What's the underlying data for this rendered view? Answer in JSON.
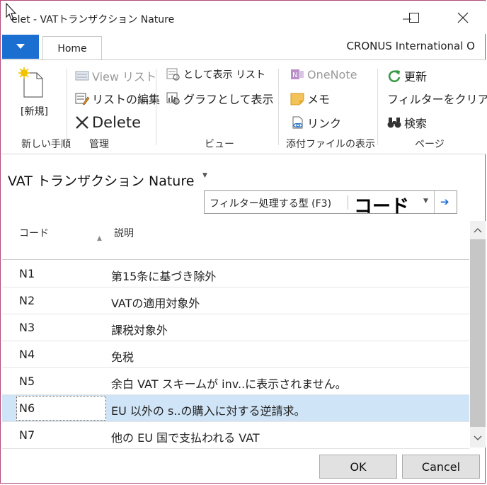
{
  "window": {
    "title": "elet - VATトランザクション  Nature",
    "company": "CRONUS International O"
  },
  "ribbon": {
    "tab_home": "Home",
    "new": {
      "label": "[新規]",
      "group": "新しい手順"
    },
    "manage": {
      "view_list": "View リスト",
      "edit_list": "リストの編集",
      "delete": "Delete",
      "group": "管理"
    },
    "view": {
      "show_as_list": "として表示 リスト",
      "show_as_chart": "グラフとして表示",
      "group": "ビュー"
    },
    "attachments": {
      "onenote": "OneNote",
      "notes": "メモ",
      "links": "リンク",
      "group": "添付ファイルの表示"
    },
    "page": {
      "refresh": "更新",
      "clear_filter": "フィルターをクリア",
      "find": "検索",
      "group": "ページ"
    }
  },
  "page": {
    "title": "VAT トランザクション  Nature"
  },
  "filter": {
    "label": "フィルター処理する型 (F3)",
    "field": "コード"
  },
  "grid": {
    "columns": [
      "コード",
      "説明"
    ],
    "rows": [
      {
        "code": "N1",
        "description": "第15条に基づき除外"
      },
      {
        "code": "N2",
        "description": "VATの適用対象外"
      },
      {
        "code": "N3",
        "description": "課税対象外"
      },
      {
        "code": "N4",
        "description": "免税"
      },
      {
        "code": "N5",
        "description": "余白 VAT スキームが inv..に表示されません。"
      },
      {
        "code": "N6",
        "description": "EU 以外の s..の購入に対する逆請求。"
      },
      {
        "code": "N7",
        "description": "他の EU 国で支払われる VAT"
      }
    ],
    "selected_row": "N6"
  },
  "buttons": {
    "ok": "OK",
    "cancel": "Cancel"
  },
  "colors": {
    "accent": "#1a6fd1",
    "selection": "#cfe4f6",
    "frame": "#b24a7a"
  }
}
